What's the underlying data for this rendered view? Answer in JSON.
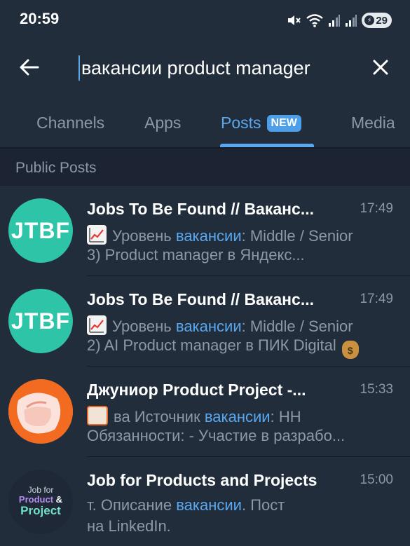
{
  "status_bar": {
    "time": "20:59",
    "battery": "29",
    "icons": [
      "mute-icon",
      "wifi-icon",
      "signal-icon",
      "signal-icon",
      "battery-icon"
    ]
  },
  "search": {
    "query": "вакансии product manager",
    "back_icon": "back-arrow-icon",
    "clear_icon": "close-icon"
  },
  "tabs": [
    {
      "label": "Channels",
      "active": false
    },
    {
      "label": "Apps",
      "active": false
    },
    {
      "label": "Posts",
      "active": true,
      "badge": "NEW"
    },
    {
      "label": "Media",
      "active": false
    }
  ],
  "section_label": "Public Posts",
  "results": [
    {
      "avatar_text": "JTBF",
      "title": "Jobs To Be Found // Ваканс...",
      "time": "17:49",
      "line1_prefix": "Уровень",
      "line1_highlight": "вакансии",
      "line1_suffix": ": Middle / Senior",
      "line2": "3) Product manager в Яндекс..."
    },
    {
      "avatar_text": "JTBF",
      "title": "Jobs To Be Found // Ваканс...",
      "time": "17:49",
      "line1_prefix": "Уровень",
      "line1_highlight": "вакансии",
      "line1_suffix": ": Middle / Senior",
      "line2": "2) AI Product manager в ПИК Digital"
    },
    {
      "title": "Джуниор Product Project -...",
      "time": "15:33",
      "line1_prefix": "ва Источник",
      "line1_highlight": "вакансии",
      "line1_suffix": ": HH",
      "line2": "Обязанности: - Участие в разрабо..."
    },
    {
      "avatar_lines": [
        "Job for",
        "Product",
        "&",
        "Project"
      ],
      "title": "Job for Products and Projects",
      "time": "15:00",
      "line1_prefix": "т. Описание",
      "line1_highlight": "вакансии",
      "line1_suffix": ". Пост",
      "line2": "на LinkedIn."
    }
  ],
  "colors": {
    "background": "#1c2433",
    "surface": "#212d3b",
    "accent": "#5aa7ee",
    "muted_text": "#8c98a8",
    "jtbf_avatar": "#2ec4a8",
    "junior_avatar": "#f26b21"
  }
}
